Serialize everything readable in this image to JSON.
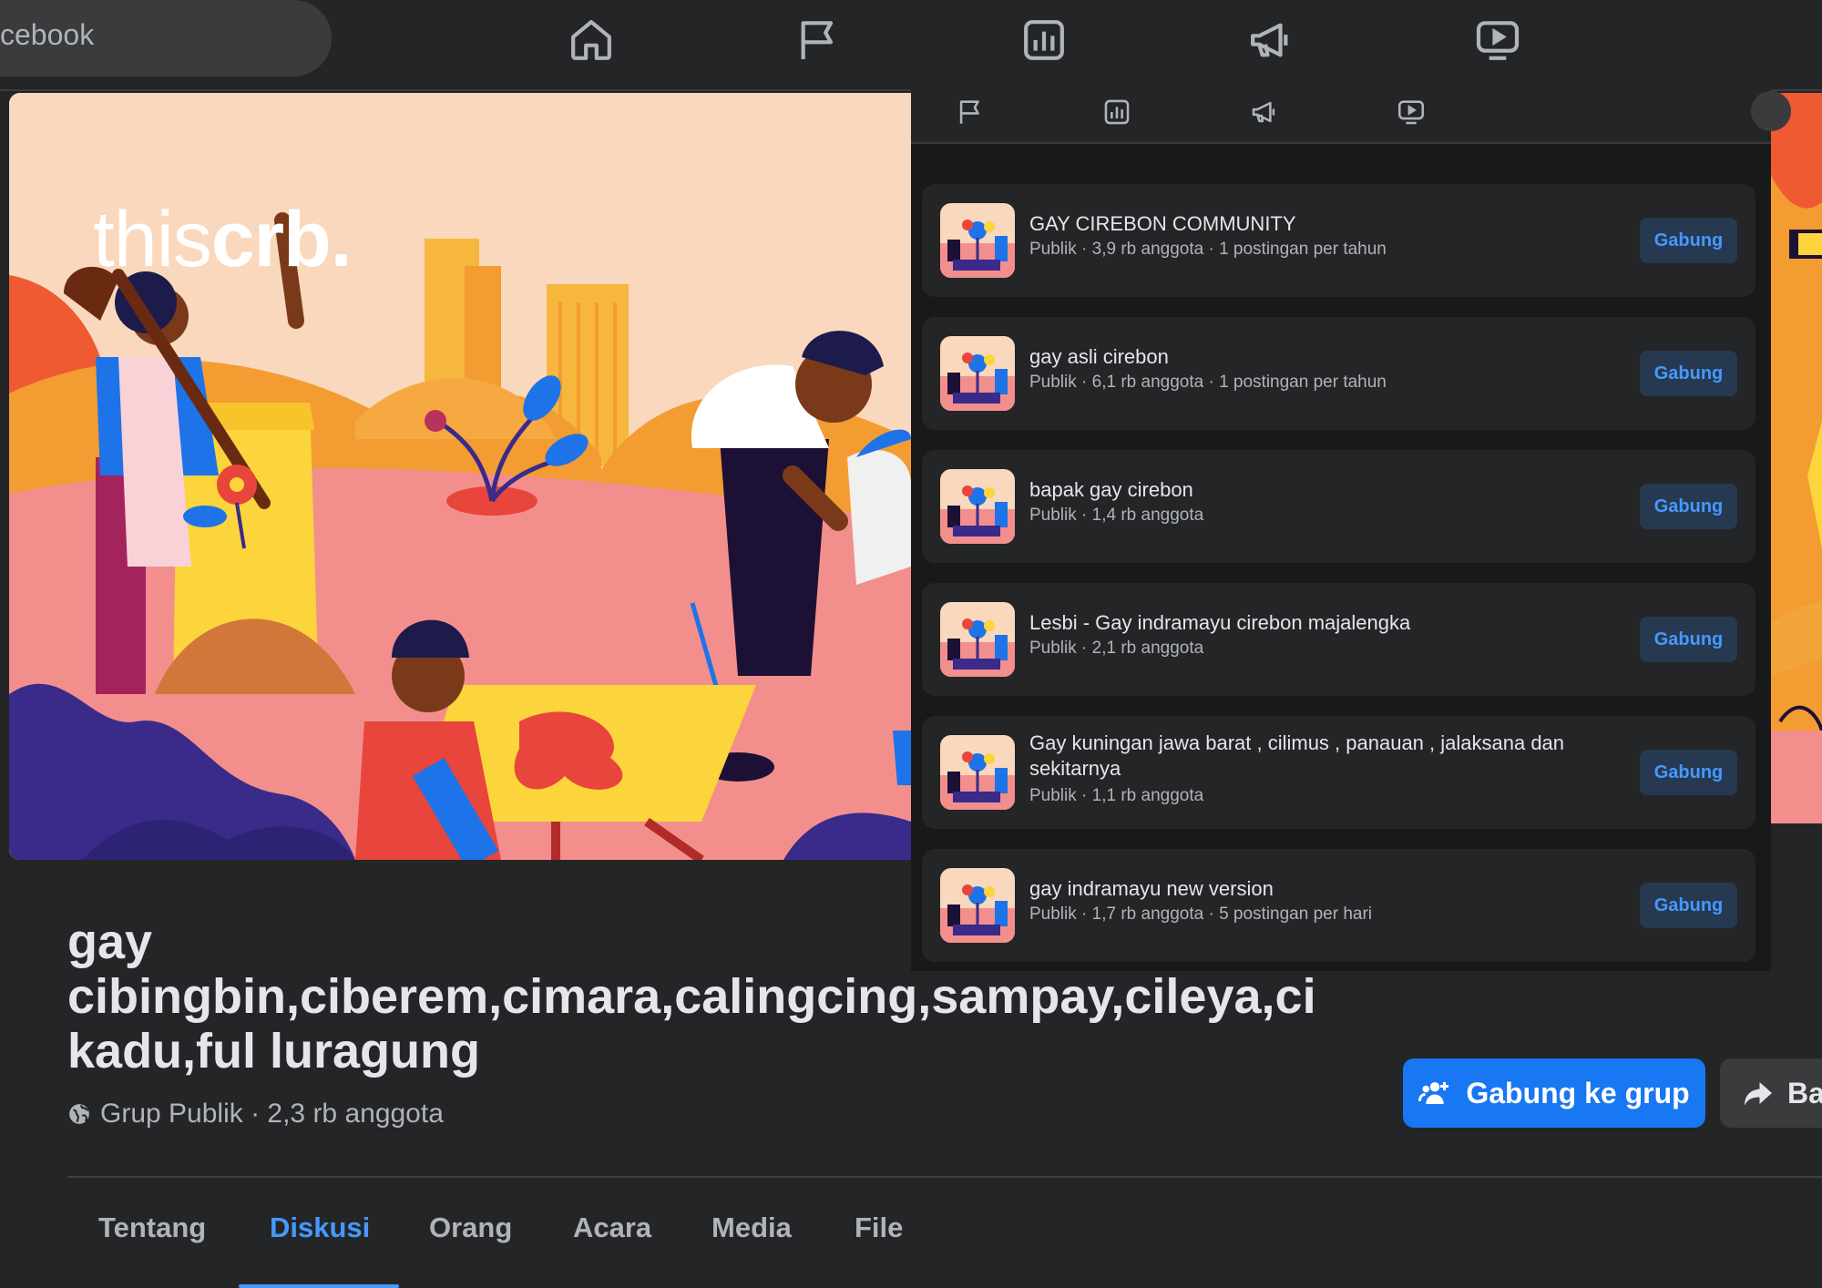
{
  "topbar": {
    "search_text": "cebook",
    "icons": [
      "home-icon",
      "flag-icon",
      "chart-icon",
      "megaphone-icon",
      "video-icon"
    ]
  },
  "cover": {
    "watermark_light": "this",
    "watermark_bold": "crb."
  },
  "suggestions": {
    "icons": [
      "flag-icon",
      "chart-icon",
      "megaphone-icon",
      "video-icon"
    ],
    "items": [
      {
        "title": "GAY CIREBON COMMUNITY",
        "meta": "Publik · 3,9 rb anggota · 1 postingan per tahun",
        "button": "Gabung"
      },
      {
        "title": "gay asli cirebon",
        "meta": "Publik · 6,1 rb anggota · 1 postingan per tahun",
        "button": "Gabung"
      },
      {
        "title": "bapak gay cirebon",
        "meta": "Publik · 1,4 rb anggota",
        "button": "Gabung"
      },
      {
        "title": "Lesbi - Gay indramayu cirebon majalengka",
        "meta": "Publik · 2,1 rb anggota",
        "button": "Gabung"
      },
      {
        "title": "Gay kuningan jawa barat , cilimus , panauan , jalaksana dan sekitarnya",
        "meta": "Publik · 1,1 rb anggota",
        "button": "Gabung"
      },
      {
        "title": "gay indramayu new version",
        "meta": "Publik · 1,7 rb anggota · 5 postingan per hari",
        "button": "Gabung"
      }
    ]
  },
  "group": {
    "title_lines": [
      "gay",
      "cibingbin,ciberem,cimara,calingcing,sampay,cileya,ci",
      "kadu,ful luragung"
    ],
    "meta": "Grup Publik · 2,3 rb anggota",
    "join_label": "Gabung ke grup",
    "share_label": "Ba"
  },
  "tabs": [
    {
      "label": "Tentang",
      "active": false
    },
    {
      "label": "Diskusi",
      "active": true
    },
    {
      "label": "Orang",
      "active": false
    },
    {
      "label": "Acara",
      "active": false
    },
    {
      "label": "Media",
      "active": false
    },
    {
      "label": "File",
      "active": false
    }
  ],
  "colors": {
    "background": "#242526",
    "panel": "#18191a",
    "card": "#242526",
    "accent": "#4599ff",
    "primary_button": "#1877f2",
    "join_chip": "#263951"
  }
}
